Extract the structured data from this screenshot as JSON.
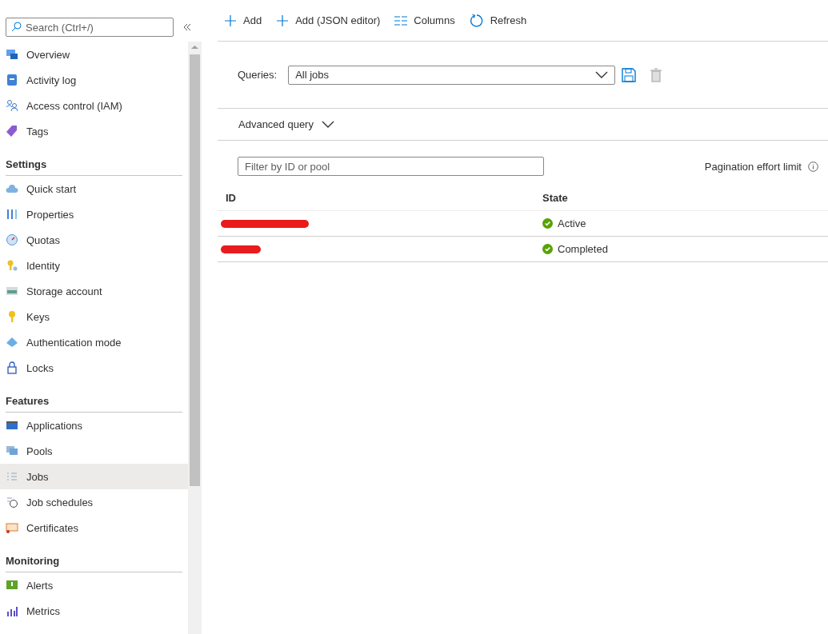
{
  "sidebar": {
    "search": {
      "placeholder": "Search (Ctrl+/)"
    },
    "sections": [
      {
        "items": [
          {
            "label": "Overview",
            "selected": false
          },
          {
            "label": "Activity log",
            "selected": false
          },
          {
            "label": "Access control (IAM)",
            "selected": false
          },
          {
            "label": "Tags",
            "selected": false
          }
        ]
      },
      {
        "title": "Settings",
        "items": [
          {
            "label": "Quick start",
            "selected": false
          },
          {
            "label": "Properties",
            "selected": false
          },
          {
            "label": "Quotas",
            "selected": false
          },
          {
            "label": "Identity",
            "selected": false
          },
          {
            "label": "Storage account",
            "selected": false
          },
          {
            "label": "Keys",
            "selected": false
          },
          {
            "label": "Authentication mode",
            "selected": false
          },
          {
            "label": "Locks",
            "selected": false
          }
        ]
      },
      {
        "title": "Features",
        "items": [
          {
            "label": "Applications",
            "selected": false
          },
          {
            "label": "Pools",
            "selected": false
          },
          {
            "label": "Jobs",
            "selected": true
          },
          {
            "label": "Job schedules",
            "selected": false
          },
          {
            "label": "Certificates",
            "selected": false
          }
        ]
      },
      {
        "title": "Monitoring",
        "items": [
          {
            "label": "Alerts",
            "selected": false
          },
          {
            "label": "Metrics",
            "selected": false
          }
        ]
      }
    ]
  },
  "toolbar": [
    {
      "kind": "add",
      "label": "Add"
    },
    {
      "kind": "add",
      "label": "Add (JSON editor)"
    },
    {
      "kind": "columns",
      "label": "Columns"
    },
    {
      "kind": "refresh",
      "label": "Refresh"
    }
  ],
  "queries": {
    "label": "Queries:",
    "value": "All jobs"
  },
  "advanced_query": {
    "label": "Advanced query",
    "expanded": false
  },
  "filter": {
    "placeholder": "Filter by ID or pool"
  },
  "pagination": {
    "label": "Pagination effort limit"
  },
  "table": {
    "columns": [
      "ID",
      "State"
    ],
    "rows": [
      {
        "redacted": true,
        "state": "Active"
      },
      {
        "redacted": true,
        "state": "Completed"
      }
    ]
  }
}
